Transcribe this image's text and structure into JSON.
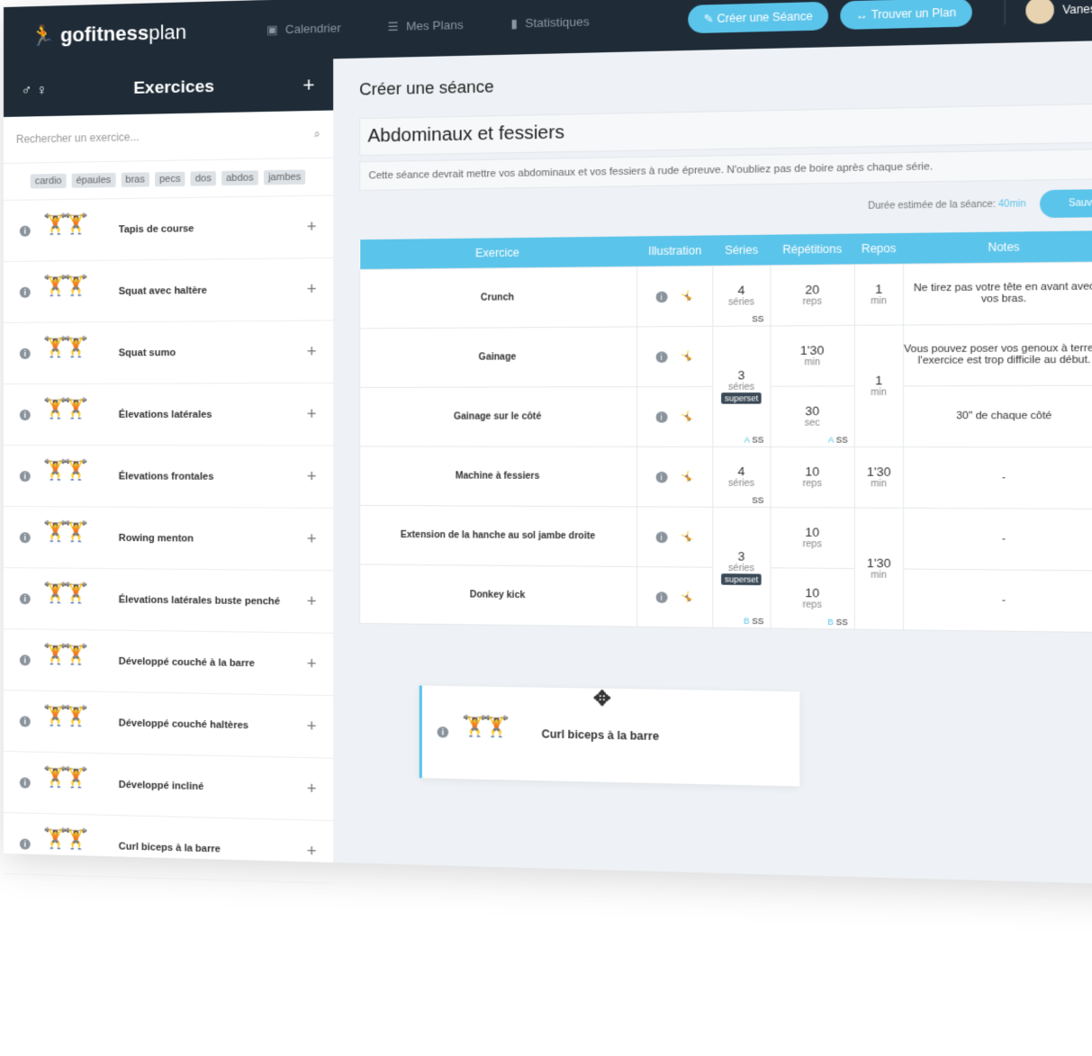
{
  "header": {
    "logo_bold": "gofitness",
    "logo_light": "plan",
    "nav": [
      {
        "icon": "calendar-icon",
        "label": "Calendrier"
      },
      {
        "icon": "list-icon",
        "label": "Mes Plans"
      },
      {
        "icon": "bar-chart-icon",
        "label": "Statistiques"
      }
    ],
    "create_btn": "Créer une Séance",
    "find_btn": "Trouver un Plan",
    "user": "Vanessa"
  },
  "sidebar": {
    "title": "Exercices",
    "search_placeholder": "Rechercher un exercice...",
    "tags": [
      "cardio",
      "épaules",
      "bras",
      "pecs",
      "dos",
      "abdos",
      "jambes"
    ],
    "items": [
      "Tapis de course",
      "Squat avec haltère",
      "Squat sumo",
      "Élevations latérales",
      "Élevations frontales",
      "Rowing menton",
      "Élevations latérales buste penché",
      "Développé couché à la barre",
      "Développé couché haltères",
      "Développé incliné",
      "Curl biceps à la barre"
    ]
  },
  "main": {
    "heading": "Créer une séance",
    "title_value": "Abdominaux et fessiers",
    "description_value": "Cette séance devrait mettre vos abdominaux et vos fessiers à rude épreuve. N'oubliez pas de boire après chaque série.",
    "duration_label": "Durée estimée de la séance:",
    "duration_value": "40min",
    "save": "Sauver",
    "columns": [
      "Exercice",
      "Illustration",
      "Séries",
      "Répétitions",
      "Repos",
      "Notes"
    ],
    "rows": [
      {
        "name": "Crunch",
        "series": "4",
        "series_unit": "séries",
        "reps": "20",
        "reps_unit": "reps",
        "rest": "1",
        "rest_unit": "min",
        "note": "Ne tirez pas votre tête en avant avec vos bras.",
        "ss": "SS",
        "group": ""
      },
      {
        "name": "Gainage",
        "series": "3",
        "series_unit": "séries",
        "badge": "superset",
        "reps": "1'30",
        "reps_unit": "min",
        "rest": "1",
        "rest_unit": "min",
        "note": "Vous pouvez poser vos genoux à terre si l'exercice est trop difficile au début.",
        "ss": "SS",
        "group": "A"
      },
      {
        "name": "Gainage sur le côté",
        "reps": "30",
        "reps_unit": "sec",
        "note": "30\" de chaque côté",
        "ss": "SS",
        "group": "A"
      },
      {
        "name": "Machine à fessiers",
        "series": "4",
        "series_unit": "séries",
        "reps": "10",
        "reps_unit": "reps",
        "rest": "1'30",
        "rest_unit": "min",
        "note": "-",
        "ss": "SS",
        "group": ""
      },
      {
        "name": "Extension de la hanche au sol jambe droite",
        "series": "3",
        "series_unit": "séries",
        "badge": "superset",
        "reps": "10",
        "reps_unit": "reps",
        "rest": "1'30",
        "rest_unit": "min",
        "note": "-",
        "ss": "SS",
        "group": "B"
      },
      {
        "name": "Donkey kick",
        "reps": "10",
        "reps_unit": "reps",
        "note": "-",
        "ss": "SS",
        "group": "B"
      }
    ]
  },
  "dragging": {
    "name": "Curl biceps à la barre"
  }
}
